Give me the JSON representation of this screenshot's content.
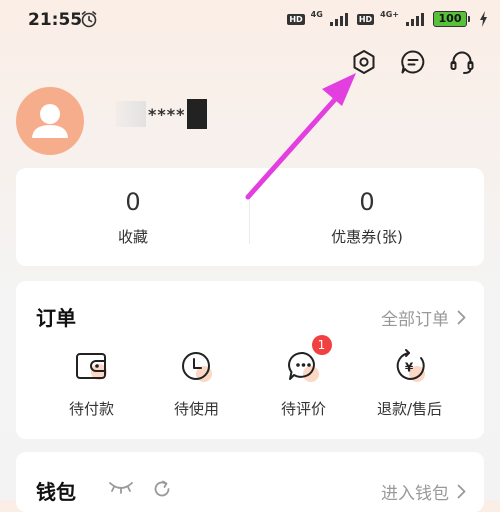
{
  "status_bar": {
    "time": "21:55",
    "hd1": "HD",
    "net1": "4G",
    "hd2": "HD",
    "net2": "4G+",
    "battery": "100"
  },
  "header": {
    "icons": [
      "settings-icon",
      "message-icon",
      "customer-service-icon"
    ]
  },
  "profile": {
    "username_masked": "****"
  },
  "stats": [
    {
      "value": "0",
      "label": "收藏"
    },
    {
      "value": "0",
      "label": "优惠券(张)"
    }
  ],
  "orders": {
    "title": "订单",
    "all_label": "全部订单",
    "items": [
      {
        "label": "待付款",
        "icon": "wallet-icon"
      },
      {
        "label": "待使用",
        "icon": "clock-icon"
      },
      {
        "label": "待评价",
        "icon": "comment-icon",
        "badge": "1"
      },
      {
        "label": "退款/售后",
        "icon": "refund-icon"
      }
    ]
  },
  "wallet": {
    "title": "钱包",
    "enter_label": "进入钱包"
  },
  "colors": {
    "accent_pink": "#e33ee0",
    "badge_red": "#f23f3f",
    "avatar_bg": "#f6ad8c",
    "highlight_peach": "#fbd7c4"
  }
}
